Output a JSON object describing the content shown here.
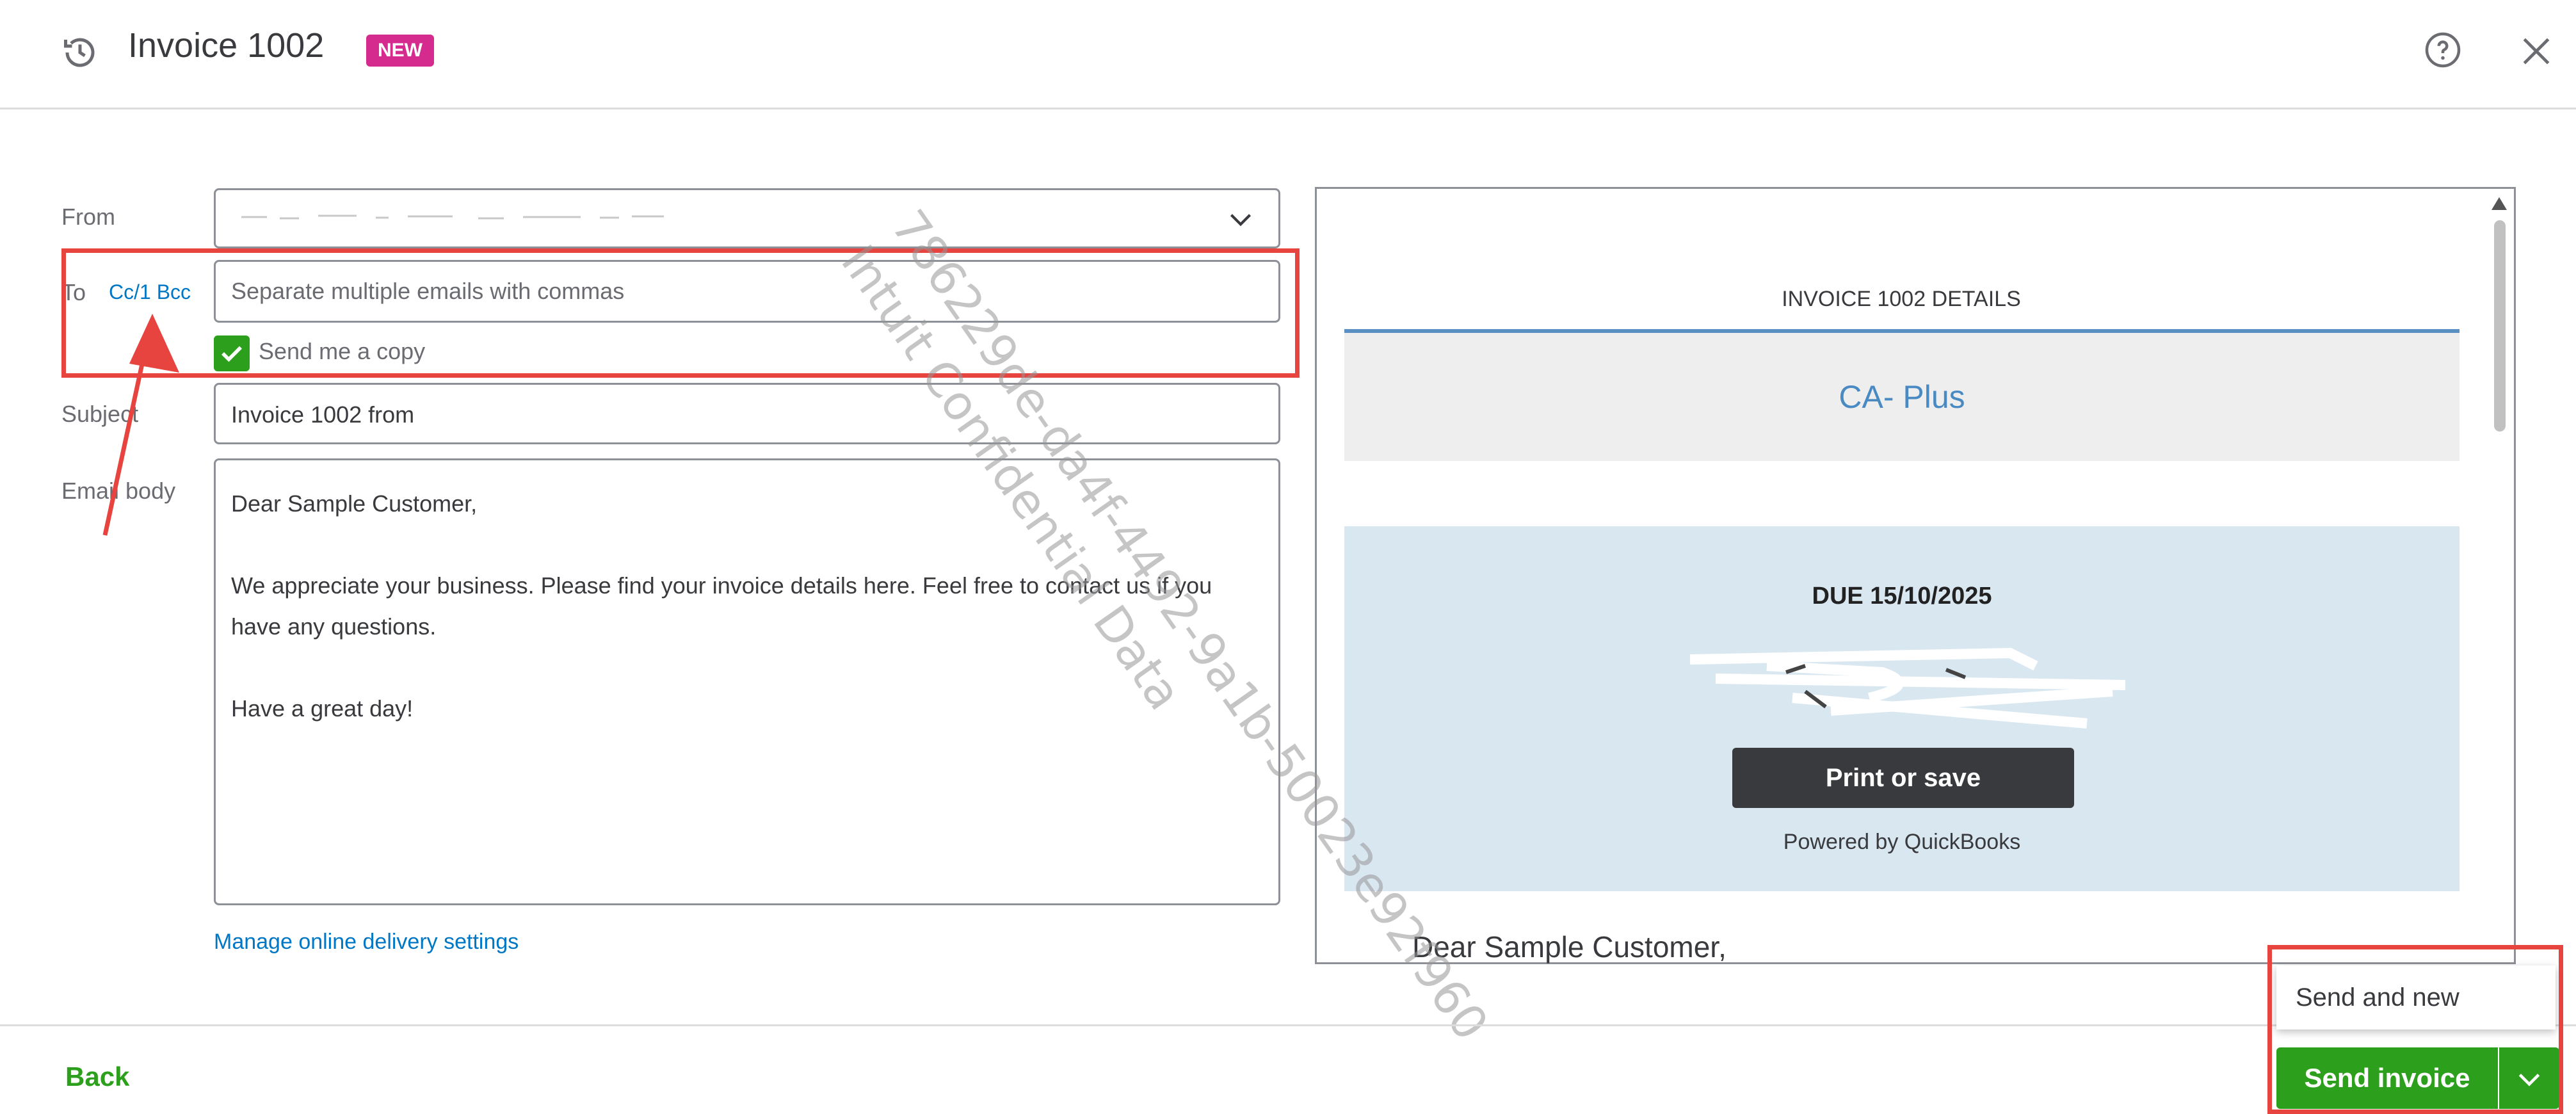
{
  "header": {
    "title": "Invoice 1002",
    "badge": "NEW",
    "icons": [
      "history-icon",
      "help-icon",
      "close-icon"
    ]
  },
  "form": {
    "from_label": "From",
    "to_label": "To",
    "cc_bcc_label": "Cc/1 Bcc",
    "to_placeholder": "Separate multiple emails with commas",
    "send_copy_label": "Send me a copy",
    "send_copy_checked": true,
    "subject_label": "Subject",
    "subject_value": "Invoice 1002 from",
    "body_label": "Email body",
    "body_lines": [
      "Dear Sample Customer,",
      "We appreciate your business. Please find your invoice details here. Feel free to contact us if you have any questions.",
      "Have a great day!"
    ],
    "manage_link": "Manage online delivery settings"
  },
  "preview": {
    "heading": "INVOICE 1002 DETAILS",
    "company": "CA- Plus",
    "due": "DUE 15/10/2025",
    "print_button": "Print or save",
    "powered_by": "Powered by QuickBooks",
    "greeting": "Dear Sample Customer,"
  },
  "watermark": {
    "line1": "786229de-da4f-4492-9a1b-50023e92f960",
    "line2": "Intuit Confidential Data"
  },
  "footer": {
    "back": "Back",
    "send_and_new": "Send and new",
    "send_invoice": "Send invoice"
  },
  "colors": {
    "accent_green": "#2ca01c",
    "link_blue": "#0077c5",
    "badge_pink": "#d52b8f",
    "highlight_red": "#e8443f"
  }
}
